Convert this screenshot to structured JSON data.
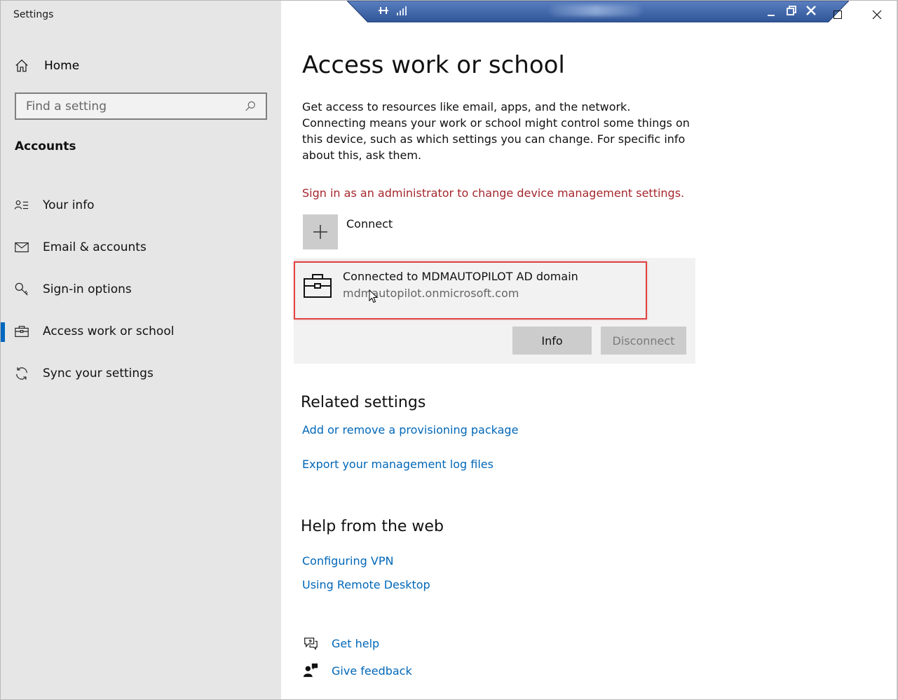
{
  "window": {
    "app_title": "Settings"
  },
  "sidebar": {
    "home_label": "Home",
    "search_placeholder": "Find a setting",
    "section_title": "Accounts",
    "items": [
      {
        "label": "Your info",
        "icon": "person-card-icon",
        "active": false
      },
      {
        "label": "Email & accounts",
        "icon": "mail-icon",
        "active": false
      },
      {
        "label": "Sign-in options",
        "icon": "key-icon",
        "active": false
      },
      {
        "label": "Access work or school",
        "icon": "briefcase-icon",
        "active": true
      },
      {
        "label": "Sync your settings",
        "icon": "sync-icon",
        "active": false
      }
    ]
  },
  "main": {
    "title": "Access work or school",
    "description": "Get access to resources like email, apps, and the network. Connecting means your work or school might control some things on this device, such as which settings you can change. For specific info about this, ask them.",
    "admin_warning": "Sign in as an administrator to change device management settings.",
    "connect_label": "Connect",
    "account": {
      "title": "Connected to MDMAUTOPILOT AD domain",
      "subtitle": "mdmautopilot.onmicrosoft.com",
      "info_button": "Info",
      "disconnect_button": "Disconnect"
    },
    "related_settings": {
      "title": "Related settings",
      "links": [
        "Add or remove a provisioning package",
        "Export your management log files"
      ]
    },
    "help_from_web": {
      "title": "Help from the web",
      "links": [
        "Configuring VPN",
        "Using Remote Desktop"
      ]
    },
    "help": {
      "get_help": "Get help",
      "give_feedback": "Give feedback"
    }
  },
  "colors": {
    "accent": "#0067c0",
    "link": "#0067b8",
    "warning": "#a4262c",
    "highlight_box": "#e04343",
    "sidebar_bg": "#e6e6e6",
    "rd_toolbar": "#2f5597"
  }
}
